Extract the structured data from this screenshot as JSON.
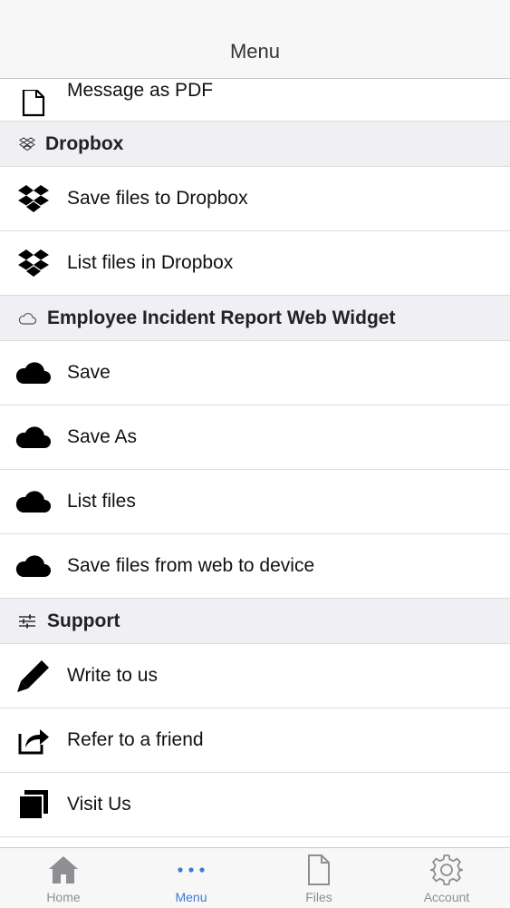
{
  "nav": {
    "title": "Menu"
  },
  "top_partial": {
    "label": "Message as PDF",
    "icon": "document-icon"
  },
  "sections": {
    "dropbox": {
      "title": "Dropbox",
      "icon": "dropbox-outline-icon",
      "items": [
        {
          "label": "Save files to Dropbox",
          "icon": "dropbox-icon"
        },
        {
          "label": "List files in Dropbox",
          "icon": "dropbox-icon"
        }
      ]
    },
    "widget": {
      "title": "Employee Incident Report Web Widget",
      "icon": "cloud-outline-icon",
      "items": [
        {
          "label": "Save",
          "icon": "cloud-icon"
        },
        {
          "label": "Save As",
          "icon": "cloud-icon"
        },
        {
          "label": "List files",
          "icon": "cloud-icon"
        },
        {
          "label": "Save files from web to device",
          "icon": "cloud-icon"
        }
      ]
    },
    "support": {
      "title": "Support",
      "icon": "sliders-icon",
      "items": [
        {
          "label": "Write to us",
          "icon": "pencil-icon"
        },
        {
          "label": "Refer to a friend",
          "icon": "share-icon"
        },
        {
          "label": "Visit Us",
          "icon": "windows-icon"
        }
      ]
    }
  },
  "tabbar": {
    "home": "Home",
    "menu": "Menu",
    "files": "Files",
    "account": "Account",
    "active_color": "#3b7bd4",
    "inactive_color": "#8e8e93"
  }
}
